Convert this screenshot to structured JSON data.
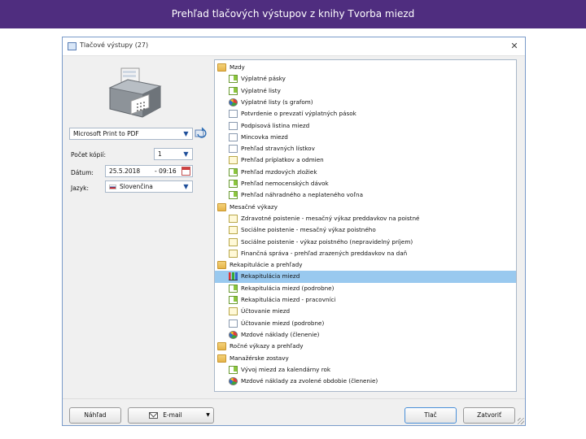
{
  "slide": {
    "title": "Prehľad tlačových výstupov z knihy Tvorba miezd"
  },
  "dialog": {
    "title": "Tlačové výstupy  (27)",
    "close_glyph": "✕",
    "printer": "Microsoft Print to PDF",
    "copies_label": "Počet kópií:",
    "copies_value": "1",
    "date_label": "Dátum:",
    "date_value": "25.5.2018",
    "time_value": "- 09:16",
    "language_label": "Jazyk:",
    "language_value": "Slovenčina"
  },
  "tree": [
    {
      "kind": "folder",
      "level": 0,
      "label": "Mzdy"
    },
    {
      "kind": "docgreen",
      "level": 1,
      "label": "Výplatné pásky"
    },
    {
      "kind": "docgreen",
      "level": 1,
      "label": "Výplatné listy"
    },
    {
      "kind": "pie",
      "level": 1,
      "label": "Výplatné listy (s grafom)"
    },
    {
      "kind": "doc",
      "level": 1,
      "label": "Potvrdenie o prevzatí výplatných pások"
    },
    {
      "kind": "doc",
      "level": 1,
      "label": "Podpisová listina miezd"
    },
    {
      "kind": "doc",
      "level": 1,
      "label": "Mincovka miezd"
    },
    {
      "kind": "doc",
      "level": 1,
      "label": "Prehľad stravných lístkov"
    },
    {
      "kind": "docyellow",
      "level": 1,
      "label": "Prehľad príplatkov a odmien"
    },
    {
      "kind": "docgreen",
      "level": 1,
      "label": "Prehľad mzdových zložiek"
    },
    {
      "kind": "docgreen",
      "level": 1,
      "label": "Prehľad nemocenských dávok"
    },
    {
      "kind": "docgreen",
      "level": 1,
      "label": "Prehľad náhradného a neplateného voľna"
    },
    {
      "kind": "folder",
      "level": 0,
      "label": "Mesačné výkazy"
    },
    {
      "kind": "docyellow",
      "level": 1,
      "label": "Zdravotné poistenie - mesačný výkaz preddavkov na poistné"
    },
    {
      "kind": "docyellow",
      "level": 1,
      "label": "Sociálne poistenie - mesačný výkaz poistného"
    },
    {
      "kind": "docyellow",
      "level": 1,
      "label": "Sociálne poistenie - výkaz poistného (nepravidelný príjem)"
    },
    {
      "kind": "docyellow",
      "level": 1,
      "label": "Finančná správa - prehľad zrazených preddavkov na daň"
    },
    {
      "kind": "folder",
      "level": 0,
      "label": "Rekapitulácie a prehľady"
    },
    {
      "kind": "bars",
      "level": 1,
      "label": "Rekapitulácia miezd",
      "selected": true
    },
    {
      "kind": "docgreen",
      "level": 1,
      "label": "Rekapitulácia miezd (podrobne)"
    },
    {
      "kind": "docgreen",
      "level": 1,
      "label": "Rekapitulácia miezd - pracovníci"
    },
    {
      "kind": "docyellow",
      "level": 1,
      "label": "Účtovanie miezd"
    },
    {
      "kind": "doc",
      "level": 1,
      "label": "Účtovanie miezd (podrobne)"
    },
    {
      "kind": "pie",
      "level": 1,
      "label": "Mzdové náklady (členenie)"
    },
    {
      "kind": "folder",
      "level": 0,
      "label": "Ročné výkazy a prehľady"
    },
    {
      "kind": "folder",
      "level": 0,
      "label": "Manažérske zostavy"
    },
    {
      "kind": "docgreen",
      "level": 1,
      "label": "Vývoj miezd za kalendárny rok"
    },
    {
      "kind": "pie",
      "level": 1,
      "label": "Mzdové náklady za zvolené obdobie (členenie)"
    }
  ],
  "buttons": {
    "preview": "Náhľad",
    "email": "E-mail",
    "split_arrow": "▼",
    "print": "Tlač",
    "close": "Zatvoriť"
  },
  "icons": {
    "dropdown": "chevron-down-icon",
    "calendar": "calendar-icon",
    "refresh": "refresh-icon"
  }
}
